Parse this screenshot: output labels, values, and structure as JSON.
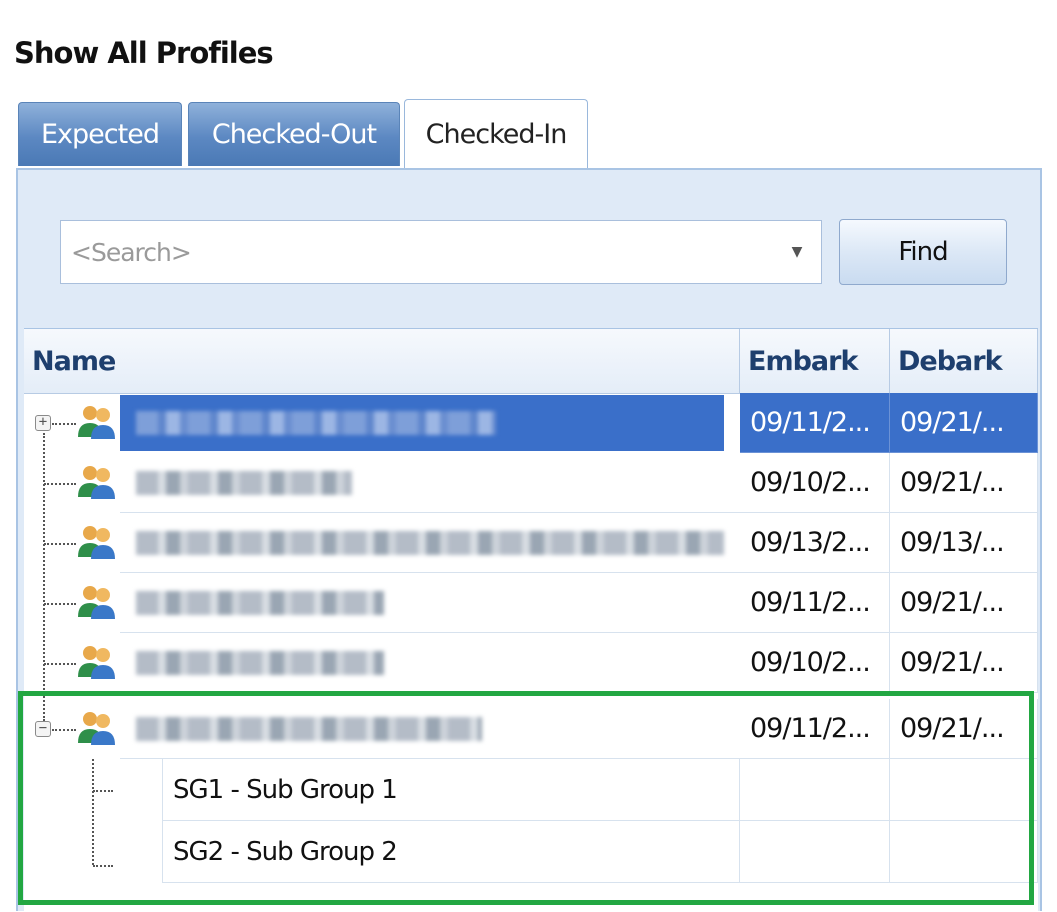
{
  "title": "Show All Profiles",
  "tabs": [
    {
      "label": "Expected",
      "active": false
    },
    {
      "label": "Checked-Out",
      "active": false
    },
    {
      "label": "Checked-In",
      "active": true
    }
  ],
  "search": {
    "placeholder": "<Search>",
    "value": ""
  },
  "find_button": "Find",
  "grid": {
    "columns": {
      "name": "Name",
      "embark": "Embark",
      "debark": "Debark"
    },
    "rows": [
      {
        "embark": "09/11/2...",
        "debark": "09/21/...",
        "selected": true,
        "expander": "+"
      },
      {
        "embark": "09/10/2...",
        "debark": "09/21/..."
      },
      {
        "embark": "09/13/2...",
        "debark": "09/13/..."
      },
      {
        "embark": "09/11/2...",
        "debark": "09/21/..."
      },
      {
        "embark": "09/10/2...",
        "debark": "09/21/..."
      },
      {
        "embark": "09/11/2...",
        "debark": "09/21/...",
        "expander": "−"
      }
    ],
    "sub_groups": [
      {
        "label": "SG1 - Sub Group 1"
      },
      {
        "label": "SG2 - Sub Group 2"
      }
    ]
  },
  "colors": {
    "selection": "#3a6fc9",
    "tab_inactive": "#5c88c2",
    "highlight": "#22a742",
    "header_text": "#1e3f6e"
  },
  "icons": {
    "group": "people-group-icon",
    "dropdown": "chevron-down-icon"
  }
}
